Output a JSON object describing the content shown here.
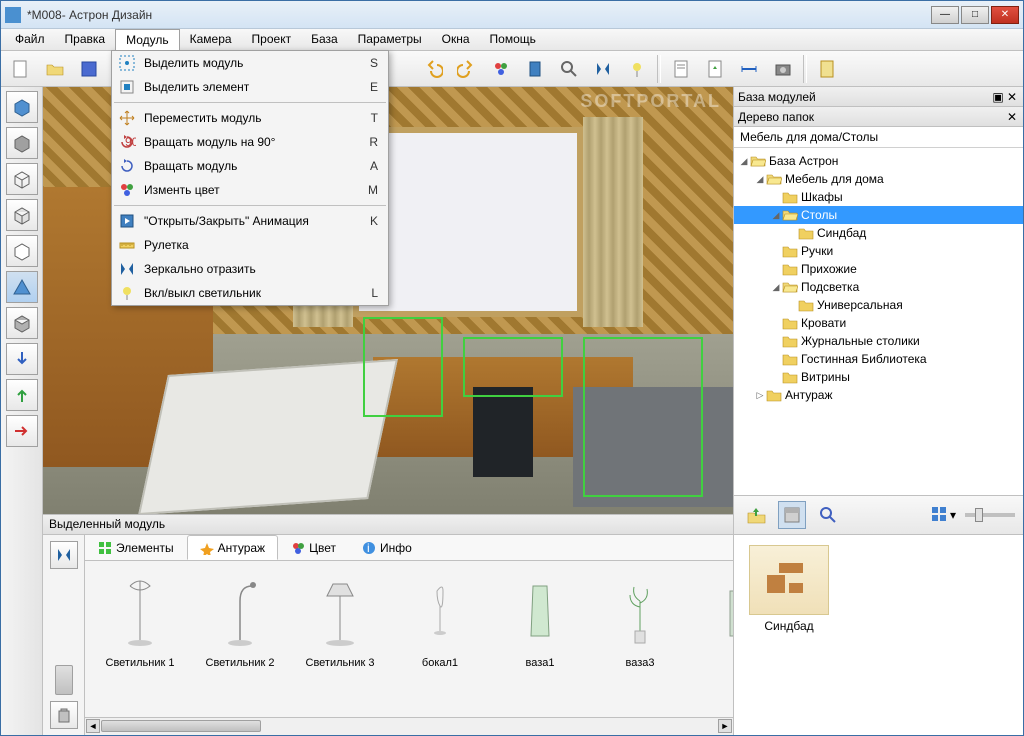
{
  "window": {
    "title": "*M008- Астрон Дизайн"
  },
  "menubar": [
    "Файл",
    "Правка",
    "Модуль",
    "Камера",
    "Проект",
    "База",
    "Параметры",
    "Окна",
    "Помощь"
  ],
  "menubar_open_index": 2,
  "dropdown": [
    {
      "icon": "select-module",
      "label": "Выделить модуль",
      "shortcut": "S"
    },
    {
      "icon": "select-element",
      "label": "Выделить элемент",
      "shortcut": "E"
    },
    {
      "sep": true
    },
    {
      "icon": "move",
      "label": "Переместить модуль",
      "shortcut": "T"
    },
    {
      "icon": "rotate90",
      "label": "Вращать модуль на 90°",
      "shortcut": "R"
    },
    {
      "icon": "rotate",
      "label": "Вращать модуль",
      "shortcut": "A"
    },
    {
      "icon": "color",
      "label": "Изменть цвет",
      "shortcut": "M"
    },
    {
      "sep": true
    },
    {
      "icon": "animation",
      "label": "\"Открыть/Закрыть\" Анимация",
      "shortcut": "K"
    },
    {
      "icon": "ruler",
      "label": "Рулетка",
      "shortcut": ""
    },
    {
      "icon": "mirror",
      "label": "Зеркально отразить",
      "shortcut": ""
    },
    {
      "icon": "light",
      "label": "Вкл/выкл светильник",
      "shortcut": "L"
    }
  ],
  "watermark": "SOFTPORTAL",
  "modpanel": {
    "title": "Выделенный модуль",
    "tabs": [
      "Элементы",
      "Антураж",
      "Цвет",
      "Инфо"
    ],
    "active_tab": 1,
    "items": [
      "Светильник 1",
      "Светильник 2",
      "Светильник 3",
      "бокал1",
      "ваза1",
      "ваза3",
      "ва"
    ]
  },
  "rightpanel": {
    "title": "База модулей",
    "subtitle": "Дерево папок",
    "path": "Мебель для дома/Столы",
    "tree": [
      {
        "d": 0,
        "exp": "open",
        "label": "База Астрон"
      },
      {
        "d": 1,
        "exp": "open",
        "label": "Мебель для дома"
      },
      {
        "d": 2,
        "exp": "leaf",
        "label": "Шкафы"
      },
      {
        "d": 2,
        "exp": "open",
        "label": "Столы",
        "sel": true
      },
      {
        "d": 3,
        "exp": "leaf",
        "label": "Синдбад"
      },
      {
        "d": 2,
        "exp": "leaf",
        "label": "Ручки"
      },
      {
        "d": 2,
        "exp": "leaf",
        "label": "Прихожие"
      },
      {
        "d": 2,
        "exp": "open",
        "label": "Подсветка"
      },
      {
        "d": 3,
        "exp": "leaf",
        "label": "Универсальная"
      },
      {
        "d": 2,
        "exp": "leaf",
        "label": "Кровати"
      },
      {
        "d": 2,
        "exp": "leaf",
        "label": "Журнальные столики"
      },
      {
        "d": 2,
        "exp": "leaf",
        "label": "Гостинная Библиотека"
      },
      {
        "d": 2,
        "exp": "leaf",
        "label": "Витрины"
      },
      {
        "d": 1,
        "exp": "closed",
        "label": "Антураж"
      }
    ],
    "gallery_item": "Синдбад"
  }
}
